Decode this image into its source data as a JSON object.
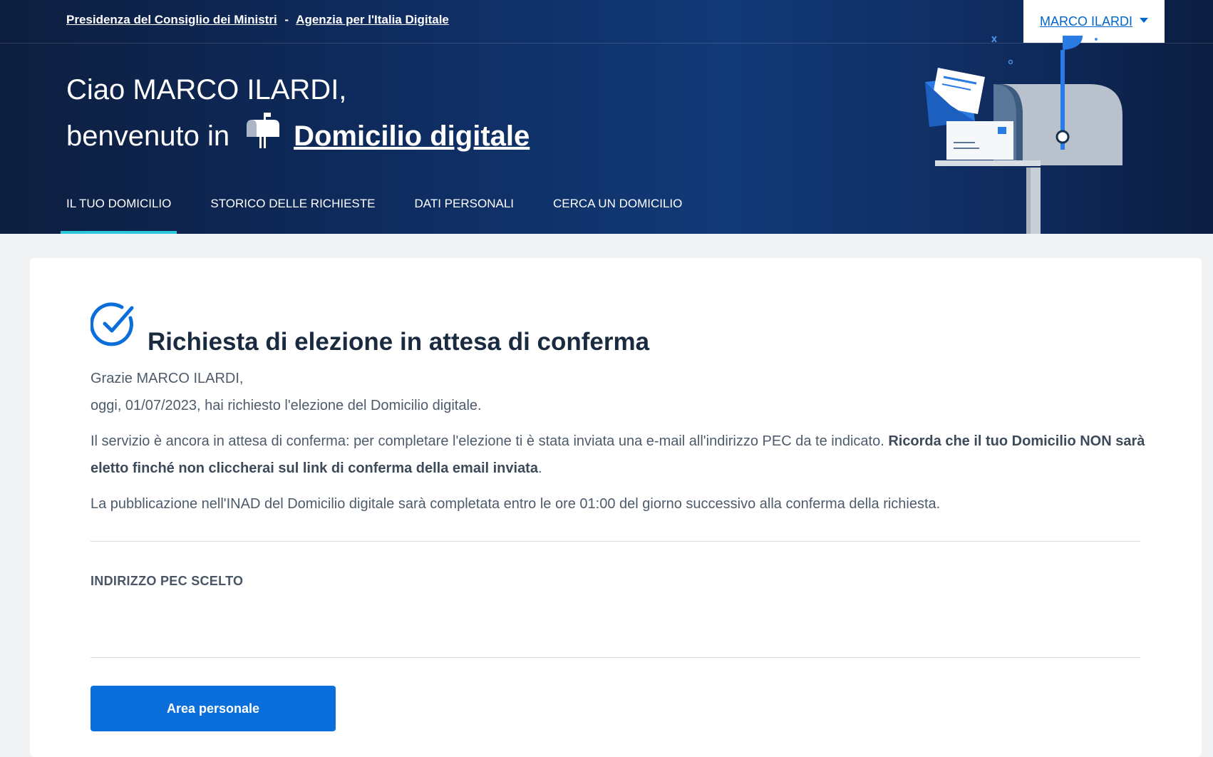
{
  "slim_header": {
    "org_link": "Presidenza del Consiglio dei Ministri",
    "separator": "-",
    "agency_link": "Agenzia per l'Italia Digitale",
    "user_menu_label": "MARCO ILARDI"
  },
  "hero": {
    "greeting": "Ciao MARCO ILARDI,",
    "welcome_prefix": "benvenuto in",
    "brand_name": "Domicilio digitale",
    "brand_icon": "mailbox-icon"
  },
  "nav": {
    "items": [
      {
        "label": "IL TUO DOMICILIO",
        "active": true
      },
      {
        "label": "STORICO DELLE RICHIESTE",
        "active": false
      },
      {
        "label": "DATI PERSONALI",
        "active": false
      },
      {
        "label": "CERCA UN DOMICILIO",
        "active": false
      }
    ]
  },
  "main": {
    "status_icon": "check-circle-icon",
    "title": "Richiesta di elezione in attesa di conferma",
    "thanks_line": "Grazie MARCO ILARDI,",
    "date_line": "oggi, 01/07/2023, hai richiesto l'elezione del Domicilio digitale.",
    "info_text": "Il servizio è ancora in attesa di conferma: per completare l'elezione ti è stata inviata una e-mail all'indirizzo PEC da te indicato.",
    "info_bold": "Ricorda che il tuo Domicilio NON sarà eletto finché non cliccherai sul link di conferma della email inviata",
    "info_end": ".",
    "publication_text": "La pubblicazione nell'INAD del Domicilio digitale sarà  completata entro le ore 01:00 del giorno successivo alla conferma della richiesta.",
    "pec_label": "INDIRIZZO PEC SCELTO",
    "pec_value": "",
    "button_label": "Area personale"
  },
  "colors": {
    "header_bg": "#0f2d62",
    "accent": "#2dc7db",
    "primary": "#0a6fdb",
    "link": "#0066cc"
  }
}
